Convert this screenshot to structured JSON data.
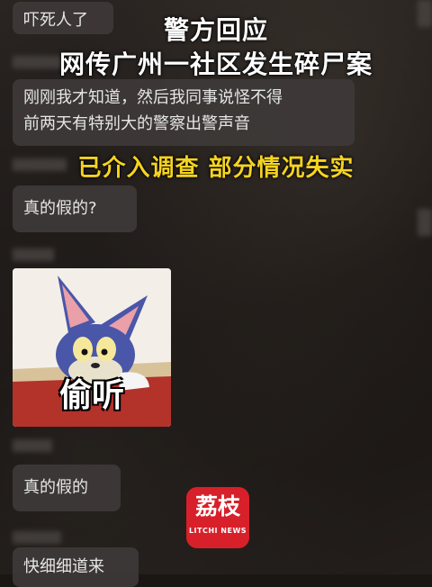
{
  "headline": {
    "line1": "警方回应",
    "line2": "网传广州一社区发生碎尸案",
    "status": "已介入调查 部分情况失实"
  },
  "messages": [
    {
      "text": "吓死人了"
    },
    {
      "text": "刚刚我才知道，然后我同事说怪不得前两天有特别大的警察出警声音",
      "lines": [
        "刚刚我才知道，然后我同事说怪不得",
        "前两天有特别大的警察出警声音"
      ]
    },
    {
      "text": "真的假的?"
    },
    {
      "text": "真的假的"
    },
    {
      "text": "快细细道来"
    }
  ],
  "sticker": {
    "caption": "偷听"
  },
  "logo": {
    "main": "荔枝",
    "sub": "LITCHI NEWS"
  },
  "colors": {
    "highlight": "#f5d322",
    "logo_bg": "#d8202a"
  }
}
